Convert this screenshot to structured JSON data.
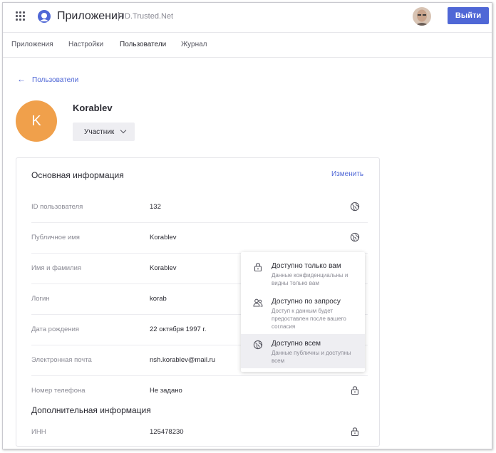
{
  "header": {
    "app_title": "Приложения",
    "app_subtitle": "ID.Trusted.Net",
    "logout_label": "Выйти",
    "colors": {
      "accent": "#4f67d6",
      "avatar_bg": "#f0a04b"
    }
  },
  "nav": {
    "items": [
      {
        "label": "Приложения"
      },
      {
        "label": "Настройки"
      },
      {
        "label": "Пользователи"
      },
      {
        "label": "Журнал"
      }
    ],
    "active": "Пользователи"
  },
  "breadcrumb": {
    "back_label": "Пользователи"
  },
  "user": {
    "initial": "K",
    "name": "Korablev",
    "role": "Участник"
  },
  "basic_info": {
    "title": "Основная информация",
    "edit_label": "Изменить",
    "rows": [
      {
        "label": "ID пользователя",
        "value": "132",
        "icon": "globe-icon"
      },
      {
        "label": "Публичное имя",
        "value": "Korablev",
        "icon": "globe-icon"
      },
      {
        "label": "Имя и фамилия",
        "value": "Korablev",
        "icon": ""
      },
      {
        "label": "Логин",
        "value": "korab",
        "icon": ""
      },
      {
        "label": "Дата рождения",
        "value": "22 октября 1997 г.",
        "icon": ""
      },
      {
        "label": "Электронная почта",
        "value": "nsh.korablev@mail.ru",
        "icon": ""
      },
      {
        "label": "Номер телефона",
        "value": "Не задано",
        "icon": "lock-icon"
      }
    ]
  },
  "extra_info": {
    "title": "Дополнительная информация",
    "rows": [
      {
        "label": "ИНН",
        "value": "125478230",
        "icon": "lock-icon"
      }
    ]
  },
  "visibility_menu": {
    "selected": "Доступно всем",
    "options": [
      {
        "icon": "lock-icon",
        "title": "Доступно только вам",
        "desc": "Данные конфиденциальны и видны только вам"
      },
      {
        "icon": "users-icon",
        "title": "Доступно по запросу",
        "desc": "Доступ к данным будет предоставлен после вашего согласия"
      },
      {
        "icon": "globe-icon",
        "title": "Доступно всем",
        "desc": "Данные публичны и доступны всем"
      }
    ]
  }
}
